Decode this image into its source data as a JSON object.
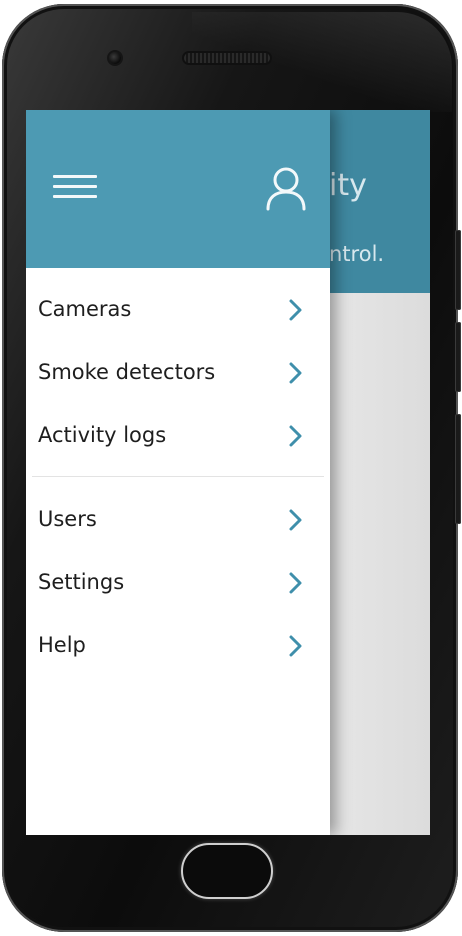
{
  "background_app": {
    "title_fragment": "ity",
    "subtitle_fragment": "ntrol."
  },
  "drawer": {
    "header_color": "#4d9ab3",
    "accent_color": "#3f8fab",
    "menu_icon": "hamburger-menu-icon",
    "user_icon": "user-profile-icon",
    "items": [
      {
        "label": "Cameras",
        "icon": "chevron-right-icon"
      },
      {
        "label": "Smoke detectors",
        "icon": "chevron-right-icon"
      },
      {
        "label": "Activity logs",
        "icon": "chevron-right-icon"
      },
      {
        "label": "Users",
        "icon": "chevron-right-icon"
      },
      {
        "label": "Settings",
        "icon": "chevron-right-icon"
      },
      {
        "label": "Help",
        "icon": "chevron-right-icon"
      }
    ]
  }
}
